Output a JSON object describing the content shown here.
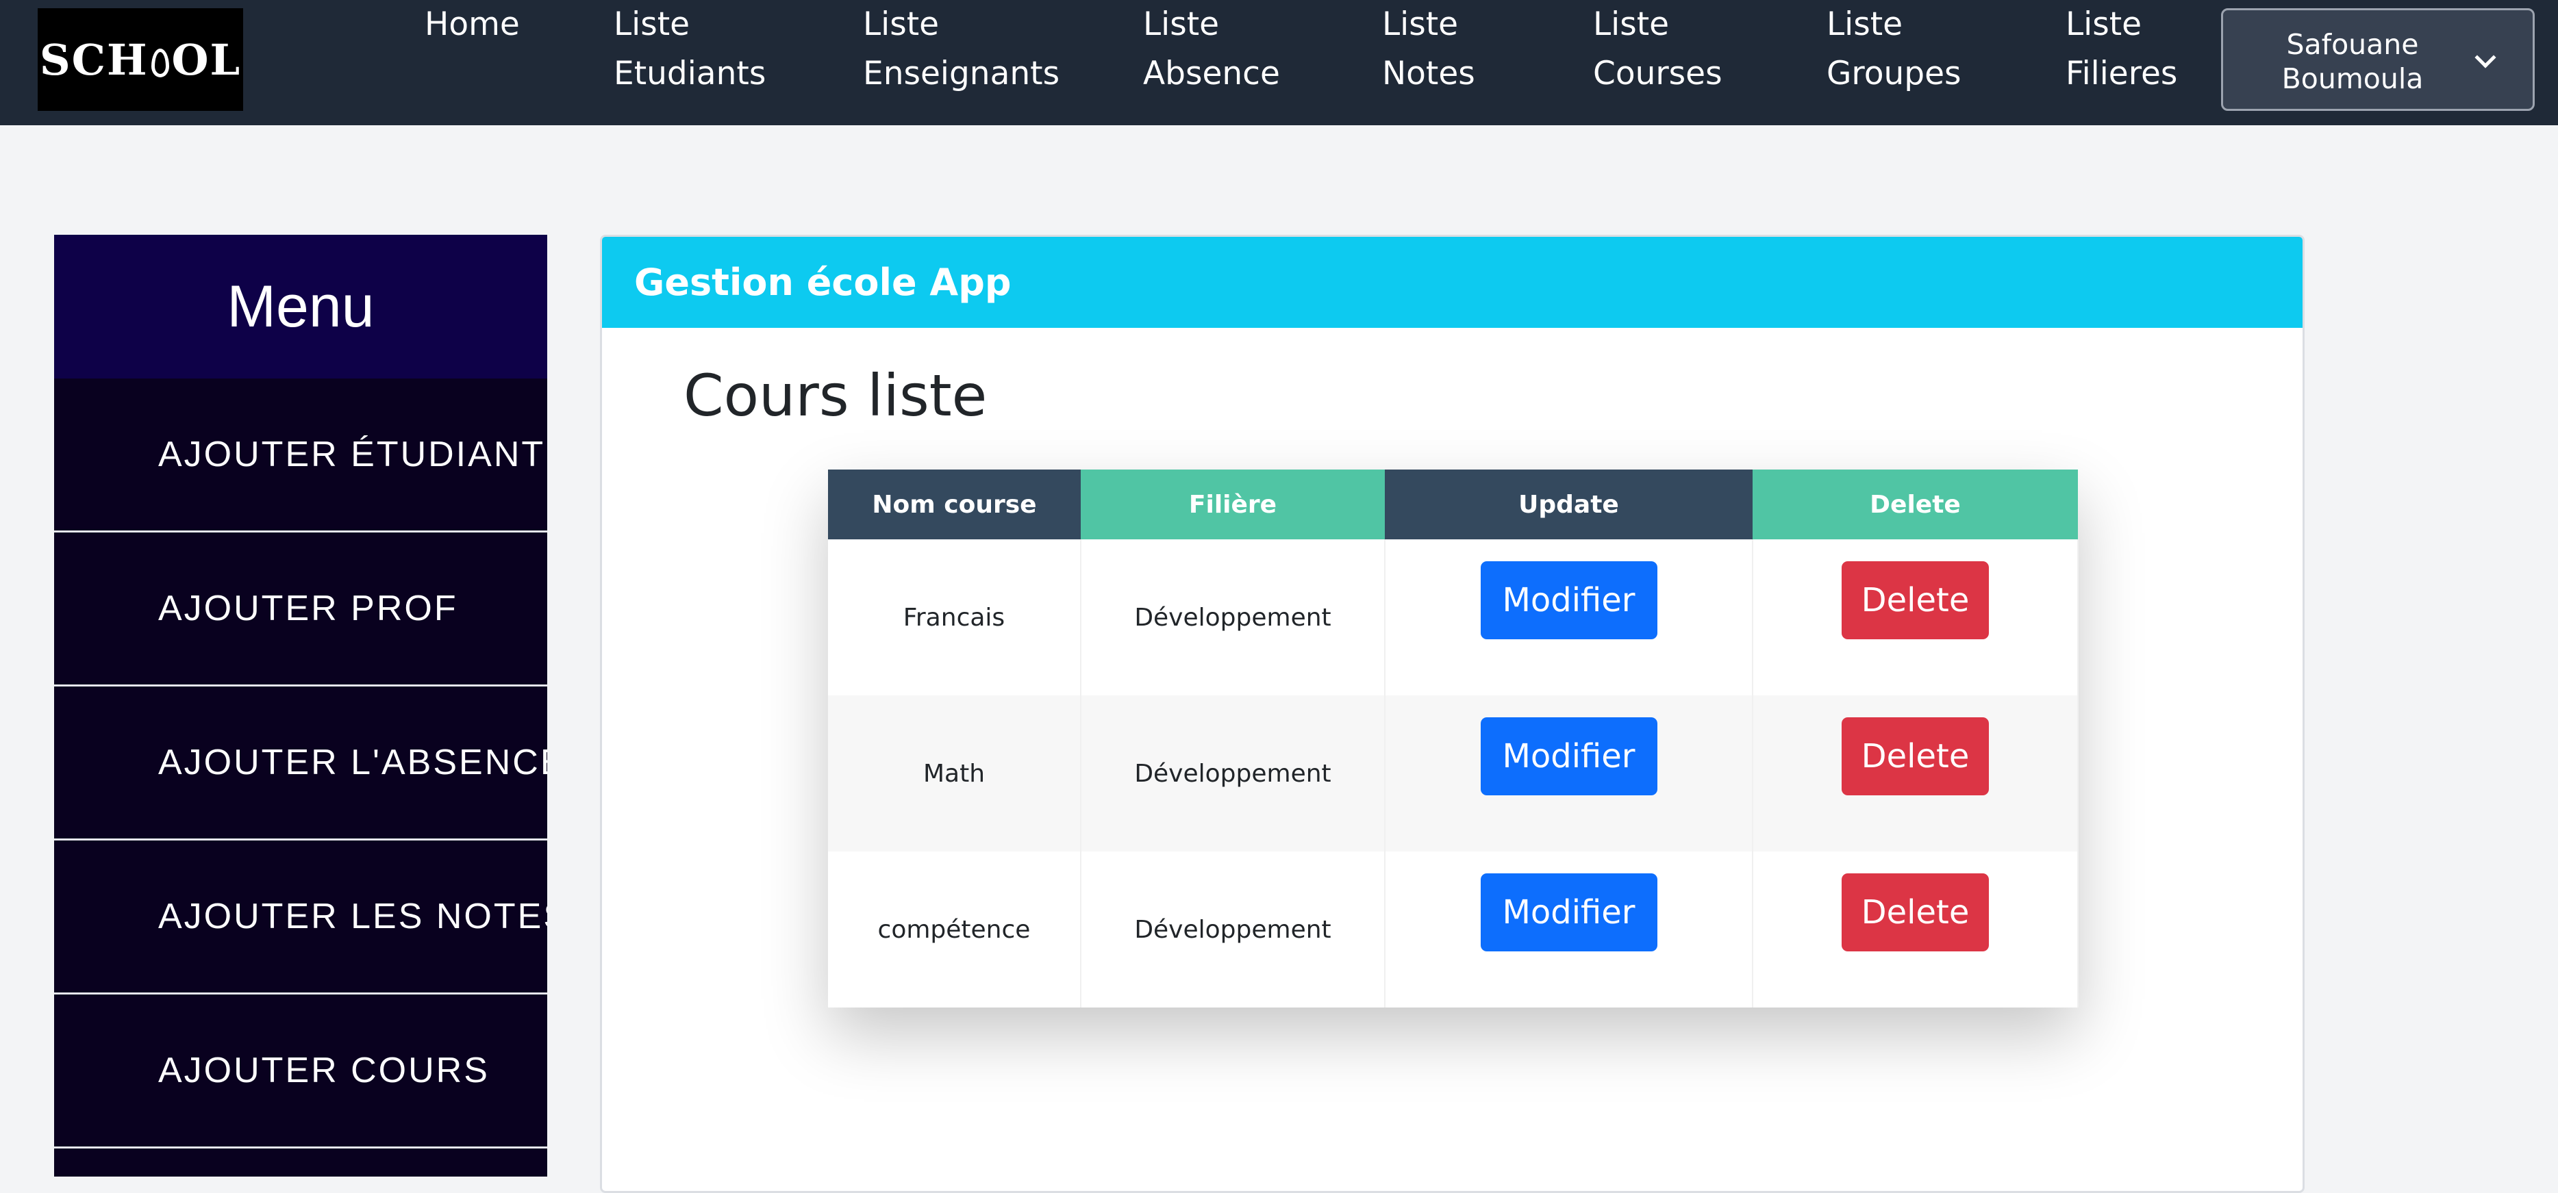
{
  "navbar": {
    "logo_text": "SCHOOL",
    "items": [
      {
        "line1": "Home",
        "line2": ""
      },
      {
        "line1": "Liste",
        "line2": "Etudiants"
      },
      {
        "line1": "Liste",
        "line2": "Enseignants"
      },
      {
        "line1": "Liste",
        "line2": "Absence"
      },
      {
        "line1": "Liste",
        "line2": "Notes"
      },
      {
        "line1": "Liste",
        "line2": "Courses"
      },
      {
        "line1": "Liste",
        "line2": "Groupes"
      },
      {
        "line1": "Liste",
        "line2": "Filieres"
      }
    ],
    "user": {
      "first": "Safouane",
      "last": "Boumoula"
    }
  },
  "sidebar": {
    "title": "Menu",
    "items": [
      {
        "label": "AJOUTER ÉTUDIANT"
      },
      {
        "label": "AJOUTER PROF"
      },
      {
        "label": "AJOUTER L'ABSENCE"
      },
      {
        "label": "AJOUTER LES NOTES"
      },
      {
        "label": "AJOUTER COURS"
      }
    ]
  },
  "card": {
    "header": "Gestion école App",
    "title": "Cours liste"
  },
  "table": {
    "headers": [
      "Nom course",
      "Filière",
      "Update",
      "Delete"
    ],
    "rows": [
      {
        "nom": "Francais",
        "filiere": "Développement",
        "update": "Modifier",
        "delete": "Delete"
      },
      {
        "nom": "Math",
        "filiere": "Développement",
        "update": "Modifier",
        "delete": "Delete"
      },
      {
        "nom": "compétence",
        "filiere": "Développement",
        "update": "Modifier",
        "delete": "Delete"
      }
    ]
  },
  "colors": {
    "navbar": "#1f2937",
    "card_header": "#0dcaf0",
    "header_dark": "#34495e",
    "header_green": "#50c5a4",
    "btn_blue": "#0d6efd",
    "btn_red": "#dc3545"
  }
}
